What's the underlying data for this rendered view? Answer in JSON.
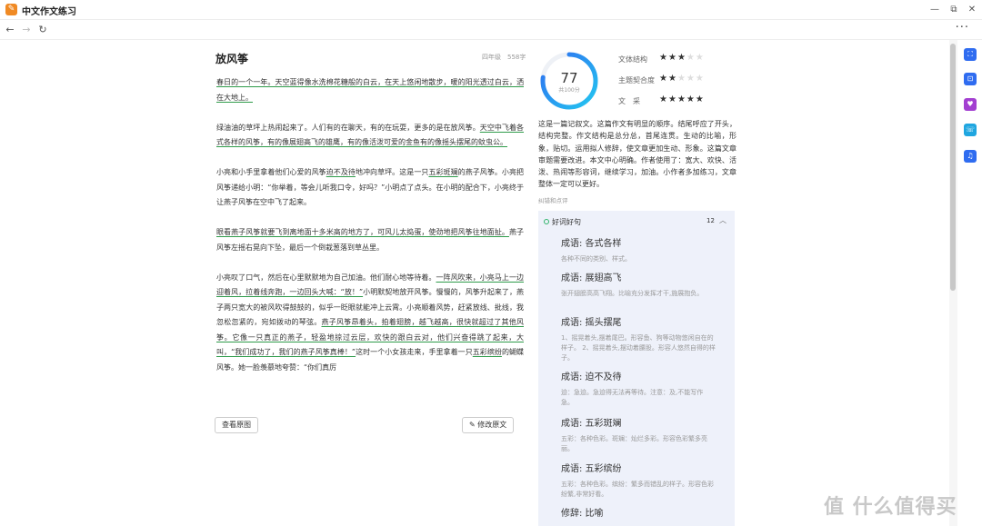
{
  "window": {
    "app_title": "中文作文练习",
    "minimize_icon": "—",
    "restore_icon": "⧉",
    "close_icon": "✕"
  },
  "nav": {
    "back_icon": "←",
    "forward_icon": "→",
    "reload_icon": "↻",
    "more_icon": "···"
  },
  "essay": {
    "title": "放风筝",
    "meta": "四年级　558字",
    "paragraphs": [
      {
        "segments": [
          {
            "text": "春日的一个一年。天空蓝得像水洗棉花糖般的白云，在天上悠闲地散步，暖的阳光透过白云，洒在大地上。",
            "hl": true
          }
        ]
      },
      {
        "segments": [
          {
            "text": "绿油油的草坪上热闹起来了。人们有的在聊天，有的在玩耍，更多的是在放风筝。",
            "hl": false
          },
          {
            "text": "天空中飞着各式各样的风筝，有的像展翅高飞的雄鹰，有的像活泼可爱的金鱼有的像摇头摆尾的蚊虫公。",
            "hl": true
          }
        ]
      },
      {
        "segments": [
          {
            "text": "小亮和小手里拿着他们心爱的风筝",
            "hl": false
          },
          {
            "text": "迫不及待",
            "hl": true
          },
          {
            "text": "地冲向草坪。这是一只",
            "hl": false
          },
          {
            "text": "五彩斑斓",
            "hl": true
          },
          {
            "text": "的燕子风筝。小亮把风筝递给小明：“你举着，等会儿听我口令，好吗？”小明点了点头。在小明的配合下，小亮终于让燕子风筝在空中飞了起来。",
            "hl": false
          }
        ]
      },
      {
        "segments": [
          {
            "text": "眼看燕子风筝就要飞到离地面十多米高的地方了，可风儿太捣蛋，使劲地把风筝往地面扯。",
            "hl": true
          },
          {
            "text": "燕子风筝左摇右晃向下坠，最后一个倒栽葱落到草丛里。",
            "hl": false
          }
        ]
      },
      {
        "segments": [
          {
            "text": "小亮叹了口气，然后在心里默默地为自己加油。他们耐心地等待着。",
            "hl": false
          },
          {
            "text": "一阵风吹来，小亮马上一边迎着风，拉着线奔跑，一边回头大喊：“放！”",
            "hl": true
          },
          {
            "text": "小明默契地放开风筝。慢慢的，风筝升起来了，燕子两只宽大的被风吹得鼓鼓的，似乎一眨眼就能冲上云霄。小亮顺着风势，赶紧放线、批线，我忽松忽紧的，宛如拨动的琴弦。",
            "hl": false
          },
          {
            "text": "燕子风筝昂着头，拍着翅膀，越飞越高，很快就超过了其他风筝。它像一只真正的燕子，轻盈地掠过云层，欢快的跟白云对，他们兴奋得跳了起来，大叫，“我们成功了，我们的燕子风筝真棒！”",
            "hl": true
          },
          {
            "text": "这时一个小女孩走来，手里拿着一只",
            "hl": false
          },
          {
            "text": "五彩缤纷",
            "hl": true
          },
          {
            "text": "的蝴蝶风筝。她一脸羡慕地夸赞：“你们真厉",
            "hl": false
          }
        ]
      }
    ],
    "view_original_label": "查看原图",
    "edit_icon": "✎",
    "edit_label": "修改原文"
  },
  "evaluation": {
    "score": "77",
    "score_sub": "共100分",
    "score_fraction": 0.77,
    "gauge_color": "#2f8ff0",
    "ratings": [
      {
        "label": "文体结构",
        "stars": 3,
        "max": 5
      },
      {
        "label": "主题契合度",
        "stars": 2,
        "max": 5
      },
      {
        "label": "文　采",
        "stars": 5,
        "max": 5
      }
    ],
    "summary": "这是一篇记叙文。这篇作文有明显的顺序。结尾呼应了开头，结构完整。作文结构是总分总，首尾连贯。生动的比喻，形象，贴切。运用拟人修辞，使文章更加生动、形象。这篇文章审题需要改进。本文中心明确。作者使用了：宽大、欢快、活泼、热闹等形容词，继续学习，加油。小作者多加练习，文章整体一定可以更好。",
    "section_label": "纠错和点评"
  },
  "good_words": {
    "title": "好词好句",
    "count": "12",
    "collapse_icon": "︿",
    "items": [
      {
        "title": "成语: 各式各样",
        "desc": "各种不同的类别、样式。"
      },
      {
        "title": "成语: 展翅高飞",
        "desc": "张开翅膀高高飞翔。比喻充分发挥才干,施展抱负。"
      },
      {
        "title": "成语: 摇头摆尾",
        "desc": "1、摇晃着头,摆着尾巴。形容鱼、狗等动物悠闲自在的样子。 2、摇晃着头,摆动着腰股。形容人悠然自得的样子。"
      },
      {
        "title": "成语: 迫不及待",
        "desc": "迫：急迫。急迫得无法再等待。注意：及,不能写作急。"
      },
      {
        "title": "成语: 五彩斑斓",
        "desc": "五彩：各种色彩。斑斓：灿烂多彩。形容色彩繁多亮丽。"
      },
      {
        "title": "成语: 五彩缤纷",
        "desc": "五彩：各种色彩。缤纷：繁多而错乱的样子。形容色彩纷繁,非常好看。"
      },
      {
        "title": "修辞: 比喻",
        "desc": ""
      }
    ]
  },
  "sidebar": {
    "icons": [
      {
        "name": "scan-icon",
        "glyph": "⛶",
        "color": "#2f6cf0"
      },
      {
        "name": "translate-icon",
        "glyph": "⊡",
        "color": "#2f6cf0"
      },
      {
        "name": "heart-icon",
        "glyph": "♥",
        "color": "#a33fd1"
      },
      {
        "name": "chat-icon",
        "glyph": "☏",
        "color": "#1fa6e0"
      },
      {
        "name": "music-icon",
        "glyph": "♫",
        "color": "#2f6cf0"
      }
    ]
  },
  "watermark": "值 什么值得买"
}
